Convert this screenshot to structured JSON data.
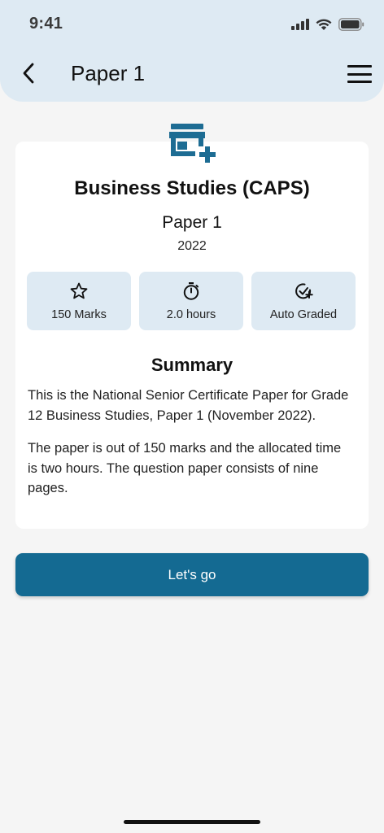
{
  "status_bar": {
    "time": "9:41"
  },
  "app_bar": {
    "title": "Paper 1"
  },
  "exam": {
    "subject": "Business Studies (CAPS)",
    "paper": "Paper 1",
    "year": "2022"
  },
  "stats": [
    {
      "icon": "star-icon",
      "label": "150 Marks"
    },
    {
      "icon": "timer-icon",
      "label": "2.0 hours"
    },
    {
      "icon": "check-circle-plus-icon",
      "label": "Auto Graded"
    }
  ],
  "summary": {
    "title": "Summary",
    "paragraphs": [
      "This is the National Senior Certificate Paper for Grade 12 Business Studies, Paper 1 (November 2022).",
      "The paper is out of 150 marks and the allocated time is two hours. The question paper consists of nine pages."
    ]
  },
  "cta": {
    "label": "Let's go"
  },
  "colors": {
    "header_bg": "#deeaf3",
    "accent": "#146a92",
    "icon": "#1d6c93"
  }
}
